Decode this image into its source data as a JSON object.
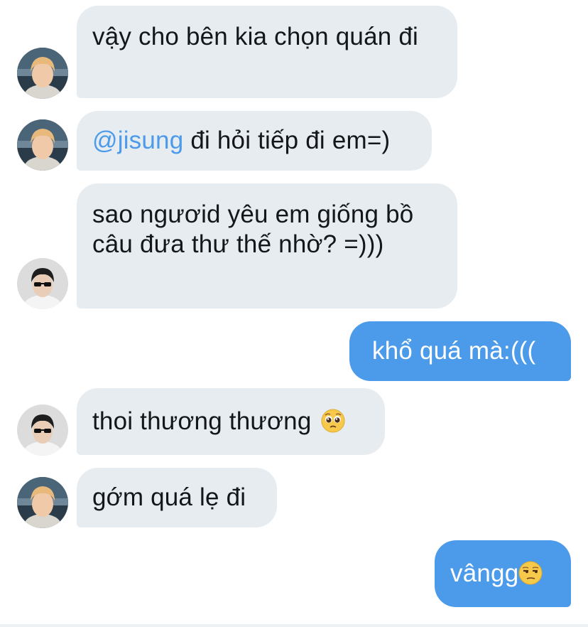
{
  "conversation": {
    "messages": [
      {
        "sender": "other",
        "avatar": "avatar-blond",
        "text": "vậy cho bên kia chọn quán đi"
      },
      {
        "sender": "other",
        "avatar": "avatar-blond",
        "mention": "@jisung",
        "text": " đi hỏi tiếp đi em=)"
      },
      {
        "sender": "other",
        "avatar": "avatar-sunglasses",
        "text": "sao ngươid yêu em giống bồ câu đưa thư thế nhờ? =)))"
      },
      {
        "sender": "me",
        "text": "khổ quá mà:((("
      },
      {
        "sender": "other",
        "avatar": "avatar-sunglasses",
        "text": "thoi thương thương",
        "emoji": "pleading-face-emoji"
      },
      {
        "sender": "other",
        "avatar": "avatar-blond",
        "text": "gớm quá lẹ đi"
      },
      {
        "sender": "me",
        "text": "vângg",
        "emoji": "unamused-face-emoji"
      }
    ]
  },
  "colors": {
    "incoming_bubble": "#e6ecf0",
    "outgoing_bubble": "#4c9bea",
    "mention": "#4c9bea",
    "text_dark": "#14171a"
  }
}
